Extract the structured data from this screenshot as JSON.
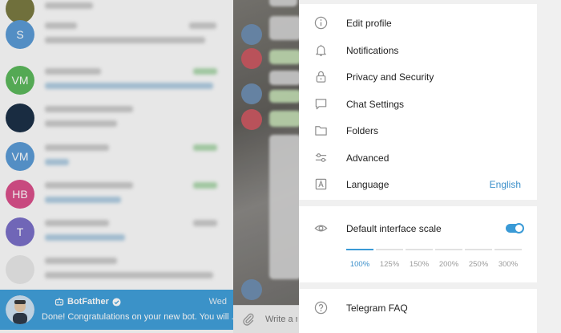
{
  "chat_list": {
    "rows": [
      {
        "initials": "",
        "color": "#8a8a4a"
      },
      {
        "initials": "S",
        "color": "#5b9bd5"
      },
      {
        "initials": "VM",
        "color": "#5cb85c"
      },
      {
        "initials": "",
        "color": "#1c3047"
      },
      {
        "initials": "VM",
        "color": "#5b9bd5"
      },
      {
        "initials": "HB",
        "color": "#d9508a"
      },
      {
        "initials": "T",
        "color": "#7a6fc7"
      },
      {
        "initials": "",
        "color": "#e8e8e8"
      }
    ],
    "active_chat": {
      "name": "BotFather",
      "time": "Wed",
      "preview": "Done! Congratulations on your new bot. You will ..."
    }
  },
  "compose": {
    "placeholder": "Write a m"
  },
  "settings": {
    "menu": [
      {
        "key": "edit_profile",
        "label": "Edit profile",
        "icon": "info-icon"
      },
      {
        "key": "notifications",
        "label": "Notifications",
        "icon": "bell-icon"
      },
      {
        "key": "privacy",
        "label": "Privacy and Security",
        "icon": "lock-icon"
      },
      {
        "key": "chat_settings",
        "label": "Chat Settings",
        "icon": "chat-bubble-icon"
      },
      {
        "key": "folders",
        "label": "Folders",
        "icon": "folder-icon"
      },
      {
        "key": "advanced",
        "label": "Advanced",
        "icon": "sliders-icon"
      },
      {
        "key": "language",
        "label": "Language",
        "value": "English",
        "icon": "language-icon"
      }
    ],
    "scale": {
      "label": "Default interface scale",
      "enabled": true,
      "options": [
        "100%",
        "125%",
        "150%",
        "200%",
        "250%",
        "300%"
      ],
      "selected": "100%"
    },
    "faq": {
      "label": "Telegram FAQ"
    }
  },
  "colors": {
    "accent": "#3a9ad6",
    "active_chat_bg": "#419fd9"
  }
}
